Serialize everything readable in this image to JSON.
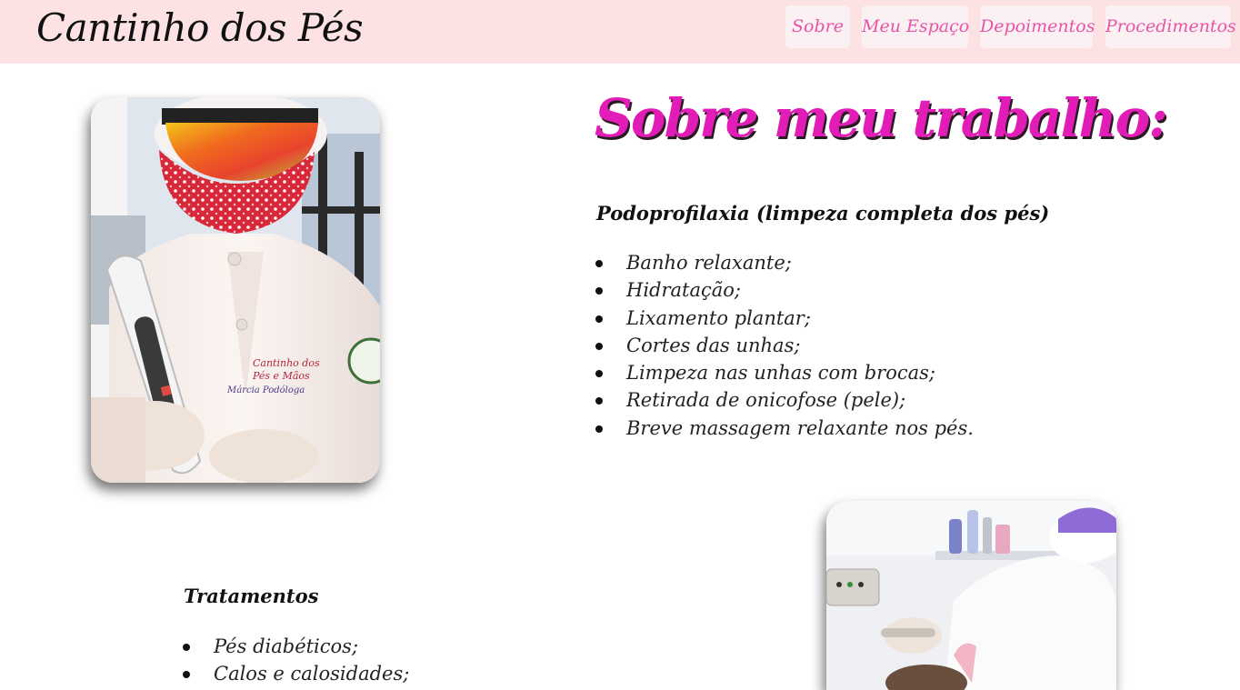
{
  "header": {
    "brand": "Cantinho dos Pés",
    "nav": [
      "Sobre",
      "Meu Espaço",
      "Depoimentos",
      "Procedimentos"
    ]
  },
  "about": {
    "title": "Sobre meu trabalho:",
    "podoprofilaxia": {
      "heading": "Podoprofilaxia (limpeza completa dos pés)",
      "items": [
        "Banho relaxante;",
        "Hidratação;",
        "Lixamento plantar;",
        "Cortes das unhas;",
        "Limpeza nas unhas com brocas;",
        "Retirada de onicofose (pele);",
        "Breve massagem relaxante nos pés."
      ]
    },
    "tratamentos": {
      "heading": "Tratamentos",
      "items": [
        "Pés diabéticos;",
        "Calos e calosidades;"
      ]
    }
  },
  "photos": {
    "first": {
      "coat_embroidery": [
        "Cantinho dos",
        "Pés e Mãos",
        "Márcia Podóloga"
      ]
    },
    "second": {}
  },
  "colors": {
    "header_bg": "#fde2e4",
    "nav_bg": "#fbf1f3",
    "nav_text": "#e754a8",
    "title": "#e21cb6"
  }
}
